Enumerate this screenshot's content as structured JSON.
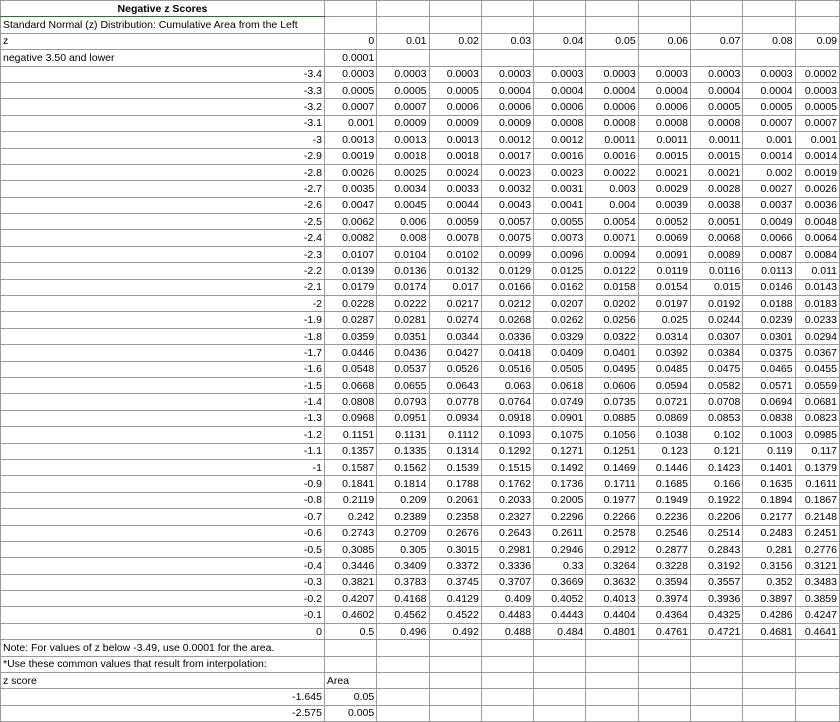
{
  "title": "Negative z Scores",
  "subtitle": "Standard Normal (z) Distribution: Cumulative Area from the Left",
  "z_header": "z",
  "col_headers": [
    "0",
    "0.01",
    "0.02",
    "0.03",
    "0.04",
    "0.05",
    "0.06",
    "0.07",
    "0.08",
    "0.09"
  ],
  "lower_row": {
    "label": "negative 3.50 and lower",
    "value": "0.0001"
  },
  "rows": [
    {
      "z": "-3.4",
      "v": [
        "0.0003",
        "0.0003",
        "0.0003",
        "0.0003",
        "0.0003",
        "0.0003",
        "0.0003",
        "0.0003",
        "0.0003",
        "0.0002"
      ]
    },
    {
      "z": "-3.3",
      "v": [
        "0.0005",
        "0.0005",
        "0.0005",
        "0.0004",
        "0.0004",
        "0.0004",
        "0.0004",
        "0.0004",
        "0.0004",
        "0.0003"
      ]
    },
    {
      "z": "-3.2",
      "v": [
        "0.0007",
        "0.0007",
        "0.0006",
        "0.0006",
        "0.0006",
        "0.0006",
        "0.0006",
        "0.0005",
        "0.0005",
        "0.0005"
      ]
    },
    {
      "z": "-3.1",
      "v": [
        "0.001",
        "0.0009",
        "0.0009",
        "0.0009",
        "0.0008",
        "0.0008",
        "0.0008",
        "0.0008",
        "0.0007",
        "0.0007"
      ]
    },
    {
      "z": "-3",
      "v": [
        "0.0013",
        "0.0013",
        "0.0013",
        "0.0012",
        "0.0012",
        "0.0011",
        "0.0011",
        "0.0011",
        "0.001",
        "0.001"
      ]
    },
    {
      "z": "-2.9",
      "v": [
        "0.0019",
        "0.0018",
        "0.0018",
        "0.0017",
        "0.0016",
        "0.0016",
        "0.0015",
        "0.0015",
        "0.0014",
        "0.0014"
      ]
    },
    {
      "z": "-2.8",
      "v": [
        "0.0026",
        "0.0025",
        "0.0024",
        "0.0023",
        "0.0023",
        "0.0022",
        "0.0021",
        "0.0021",
        "0.002",
        "0.0019"
      ]
    },
    {
      "z": "-2.7",
      "v": [
        "0.0035",
        "0.0034",
        "0.0033",
        "0.0032",
        "0.0031",
        "0.003",
        "0.0029",
        "0.0028",
        "0.0027",
        "0.0026"
      ]
    },
    {
      "z": "-2.6",
      "v": [
        "0.0047",
        "0.0045",
        "0.0044",
        "0.0043",
        "0.0041",
        "0.004",
        "0.0039",
        "0.0038",
        "0.0037",
        "0.0036"
      ]
    },
    {
      "z": "-2.5",
      "v": [
        "0.0062",
        "0.006",
        "0.0059",
        "0.0057",
        "0.0055",
        "0.0054",
        "0.0052",
        "0.0051",
        "0.0049",
        "0.0048"
      ]
    },
    {
      "z": "-2.4",
      "v": [
        "0.0082",
        "0.008",
        "0.0078",
        "0.0075",
        "0.0073",
        "0.0071",
        "0.0069",
        "0.0068",
        "0.0066",
        "0.0064"
      ]
    },
    {
      "z": "-2.3",
      "v": [
        "0.0107",
        "0.0104",
        "0.0102",
        "0.0099",
        "0.0096",
        "0.0094",
        "0.0091",
        "0.0089",
        "0.0087",
        "0.0084"
      ]
    },
    {
      "z": "-2.2",
      "v": [
        "0.0139",
        "0.0136",
        "0.0132",
        "0.0129",
        "0.0125",
        "0.0122",
        "0.0119",
        "0.0116",
        "0.0113",
        "0.011"
      ]
    },
    {
      "z": "-2.1",
      "v": [
        "0.0179",
        "0.0174",
        "0.017",
        "0.0166",
        "0.0162",
        "0.0158",
        "0.0154",
        "0.015",
        "0.0146",
        "0.0143"
      ]
    },
    {
      "z": "-2",
      "v": [
        "0.0228",
        "0.0222",
        "0.0217",
        "0.0212",
        "0.0207",
        "0.0202",
        "0.0197",
        "0.0192",
        "0.0188",
        "0.0183"
      ]
    },
    {
      "z": "-1.9",
      "v": [
        "0.0287",
        "0.0281",
        "0.0274",
        "0.0268",
        "0.0262",
        "0.0256",
        "0.025",
        "0.0244",
        "0.0239",
        "0.0233"
      ]
    },
    {
      "z": "-1.8",
      "v": [
        "0.0359",
        "0.0351",
        "0.0344",
        "0.0336",
        "0.0329",
        "0.0322",
        "0.0314",
        "0.0307",
        "0.0301",
        "0.0294"
      ]
    },
    {
      "z": "-1.7",
      "v": [
        "0.0446",
        "0.0436",
        "0.0427",
        "0.0418",
        "0.0409",
        "0.0401",
        "0.0392",
        "0.0384",
        "0.0375",
        "0.0367"
      ]
    },
    {
      "z": "-1.6",
      "v": [
        "0.0548",
        "0.0537",
        "0.0526",
        "0.0516",
        "0.0505",
        "0.0495",
        "0.0485",
        "0.0475",
        "0.0465",
        "0.0455"
      ]
    },
    {
      "z": "-1.5",
      "v": [
        "0.0668",
        "0.0655",
        "0.0643",
        "0.063",
        "0.0618",
        "0.0606",
        "0.0594",
        "0.0582",
        "0.0571",
        "0.0559"
      ]
    },
    {
      "z": "-1.4",
      "v": [
        "0.0808",
        "0.0793",
        "0.0778",
        "0.0764",
        "0.0749",
        "0.0735",
        "0.0721",
        "0.0708",
        "0.0694",
        "0.0681"
      ]
    },
    {
      "z": "-1.3",
      "v": [
        "0.0968",
        "0.0951",
        "0.0934",
        "0.0918",
        "0.0901",
        "0.0885",
        "0.0869",
        "0.0853",
        "0.0838",
        "0.0823"
      ]
    },
    {
      "z": "-1.2",
      "v": [
        "0.1151",
        "0.1131",
        "0.1112",
        "0.1093",
        "0.1075",
        "0.1056",
        "0.1038",
        "0.102",
        "0.1003",
        "0.0985"
      ]
    },
    {
      "z": "-1.1",
      "v": [
        "0.1357",
        "0.1335",
        "0.1314",
        "0.1292",
        "0.1271",
        "0.1251",
        "0.123",
        "0.121",
        "0.119",
        "0.117"
      ]
    },
    {
      "z": "-1",
      "v": [
        "0.1587",
        "0.1562",
        "0.1539",
        "0.1515",
        "0.1492",
        "0.1469",
        "0.1446",
        "0.1423",
        "0.1401",
        "0.1379"
      ]
    },
    {
      "z": "-0.9",
      "v": [
        "0.1841",
        "0.1814",
        "0.1788",
        "0.1762",
        "0.1736",
        "0.1711",
        "0.1685",
        "0.166",
        "0.1635",
        "0.1611"
      ]
    },
    {
      "z": "-0.8",
      "v": [
        "0.2119",
        "0.209",
        "0.2061",
        "0.2033",
        "0.2005",
        "0.1977",
        "0.1949",
        "0.1922",
        "0.1894",
        "0.1867"
      ]
    },
    {
      "z": "-0.7",
      "v": [
        "0.242",
        "0.2389",
        "0.2358",
        "0.2327",
        "0.2296",
        "0.2266",
        "0.2236",
        "0.2206",
        "0.2177",
        "0.2148"
      ]
    },
    {
      "z": "-0.6",
      "v": [
        "0.2743",
        "0.2709",
        "0.2676",
        "0.2643",
        "0.2611",
        "0.2578",
        "0.2546",
        "0.2514",
        "0.2483",
        "0.2451"
      ]
    },
    {
      "z": "-0.5",
      "v": [
        "0.3085",
        "0.305",
        "0.3015",
        "0.2981",
        "0.2946",
        "0.2912",
        "0.2877",
        "0.2843",
        "0.281",
        "0.2776"
      ]
    },
    {
      "z": "-0.4",
      "v": [
        "0.3446",
        "0.3409",
        "0.3372",
        "0.3336",
        "0.33",
        "0.3264",
        "0.3228",
        "0.3192",
        "0.3156",
        "0.3121"
      ]
    },
    {
      "z": "-0.3",
      "v": [
        "0.3821",
        "0.3783",
        "0.3745",
        "0.3707",
        "0.3669",
        "0.3632",
        "0.3594",
        "0.3557",
        "0.352",
        "0.3483"
      ]
    },
    {
      "z": "-0.2",
      "v": [
        "0.4207",
        "0.4168",
        "0.4129",
        "0.409",
        "0.4052",
        "0.4013",
        "0.3974",
        "0.3936",
        "0.3897",
        "0.3859"
      ]
    },
    {
      "z": "-0.1",
      "v": [
        "0.4602",
        "0.4562",
        "0.4522",
        "0.4483",
        "0.4443",
        "0.4404",
        "0.4364",
        "0.4325",
        "0.4286",
        "0.4247"
      ]
    },
    {
      "z": "0",
      "v": [
        "0.5",
        "0.496",
        "0.492",
        "0.488",
        "0.484",
        "0.4801",
        "0.4761",
        "0.4721",
        "0.4681",
        "0.4641"
      ]
    }
  ],
  "notes": [
    "Note: For values of z below -3.49, use 0.0001 for the area.",
    "*Use these common values that result from interpolation:"
  ],
  "interp": {
    "z_label": "z score",
    "area_label": "Area",
    "rows": [
      {
        "z": "-1.645",
        "area": "0.05"
      },
      {
        "z": "-2.575",
        "area": "0.005"
      }
    ]
  },
  "colors": {
    "grid": "#9a9a9a",
    "selection": "#1b7a2e"
  }
}
